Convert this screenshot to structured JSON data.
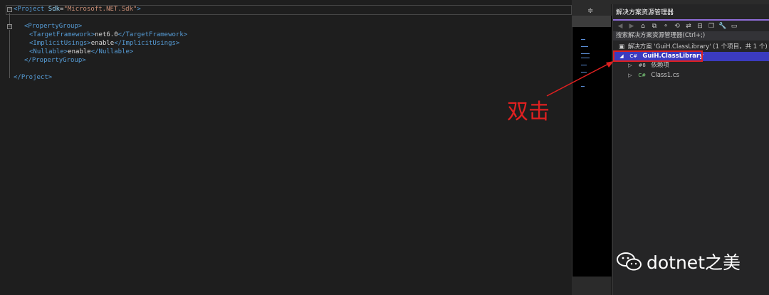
{
  "editor": {
    "lines": [
      {
        "indent": 0,
        "parts": [
          {
            "t": "<",
            "c": "tag"
          },
          {
            "t": "Project",
            "c": "tag"
          },
          {
            "t": " Sdk",
            "c": "attr"
          },
          {
            "t": "=",
            "c": "txt"
          },
          {
            "t": "\"Microsoft.NET.Sdk\"",
            "c": "str"
          },
          {
            "t": ">",
            "c": "tag"
          }
        ]
      },
      {
        "indent": 0,
        "parts": []
      },
      {
        "indent": 1,
        "parts": [
          {
            "t": "<PropertyGroup>",
            "c": "tag"
          }
        ]
      },
      {
        "indent": 2,
        "parts": [
          {
            "t": "<TargetFramework>",
            "c": "tag"
          },
          {
            "t": "net6.0",
            "c": "txt"
          },
          {
            "t": "</TargetFramework>",
            "c": "tag"
          }
        ]
      },
      {
        "indent": 2,
        "parts": [
          {
            "t": "<ImplicitUsings>",
            "c": "tag"
          },
          {
            "t": "enable",
            "c": "txt"
          },
          {
            "t": "</ImplicitUsings>",
            "c": "tag"
          }
        ]
      },
      {
        "indent": 2,
        "parts": [
          {
            "t": "<Nullable>",
            "c": "tag"
          },
          {
            "t": "enable",
            "c": "txt"
          },
          {
            "t": "</Nullable>",
            "c": "tag"
          }
        ]
      },
      {
        "indent": 1,
        "parts": [
          {
            "t": "</PropertyGroup>",
            "c": "tag"
          }
        ]
      },
      {
        "indent": 0,
        "parts": []
      },
      {
        "indent": 0,
        "parts": [
          {
            "t": "</Project>",
            "c": "tag"
          }
        ]
      }
    ]
  },
  "solution_explorer": {
    "title": "解决方案资源管理器",
    "search_placeholder": "搜索解决方案资源管理器(Ctrl+;)",
    "solution_label": "解决方案 'GuiH.ClassLibrary' (1 个项目，共 1 个)",
    "project_label": "GuiH.ClassLibrary",
    "dependencies_label": "依赖项",
    "class_file_label": "Class1.cs",
    "project_icon_text": "C#",
    "class_icon_text": "C#"
  },
  "annotation": {
    "text": "双击",
    "color": "#e02020"
  },
  "watermark": {
    "text": "dotnet之美"
  },
  "colors": {
    "editor_bg": "#1e1e1e",
    "selection": "#3b3bbf",
    "accent": "#8f6dd8"
  }
}
